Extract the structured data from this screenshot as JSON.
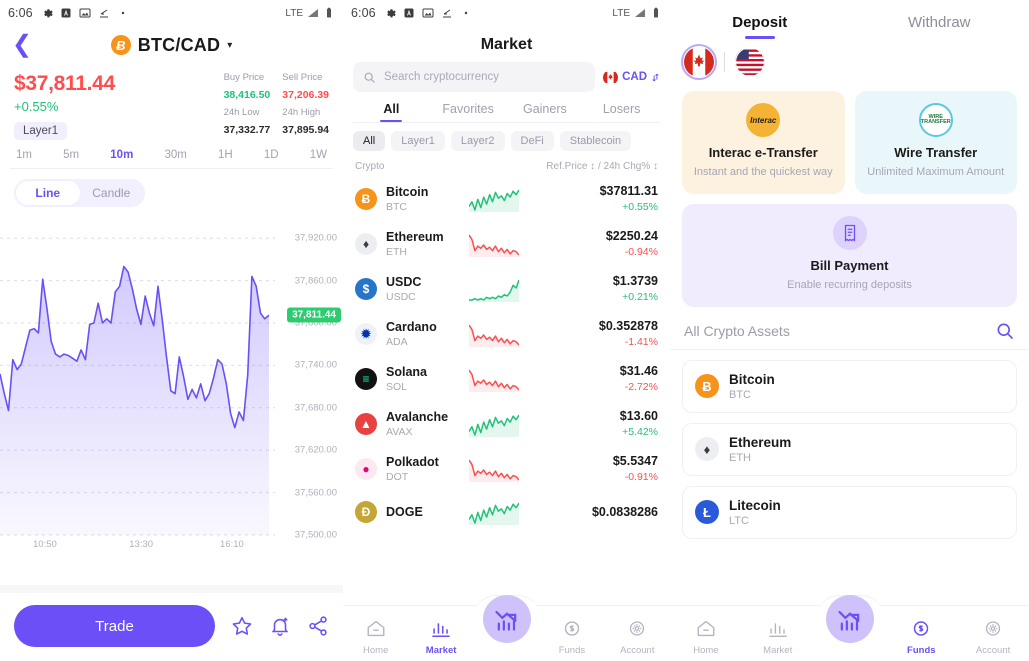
{
  "status_bar": {
    "time": "6:06",
    "icons": [
      "gear-icon",
      "app-icon",
      "gallery-icon",
      "download-icon",
      "dot-icon"
    ],
    "network": "LTE",
    "signal_icon": "signal-icon",
    "battery_icon": "battery-icon"
  },
  "trade_screen": {
    "back_icon": "chevron-left-icon",
    "pair": "BTC/CAD",
    "coin_glyph": "Ƀ",
    "caret": "▾",
    "price": "$37,811.44",
    "change": "+0.55%",
    "badge": "Layer1",
    "stats": [
      {
        "label": "Buy Price",
        "value": "38,416.50",
        "tone": "green"
      },
      {
        "label": "Sell Price",
        "value": "37,206.39",
        "tone": "red"
      },
      {
        "label": "24h Low",
        "value": "37,332.77",
        "tone": "dark"
      },
      {
        "label": "24h High",
        "value": "37,895.94",
        "tone": "dark"
      }
    ],
    "timeframes": [
      "1m",
      "5m",
      "10m",
      "30m",
      "1H",
      "1D",
      "1W"
    ],
    "timeframe_active": "10m",
    "chart_types": [
      "Line",
      "Candle"
    ],
    "chart_type_active": "Line",
    "current_price_badge": "37,811.44",
    "trade_button": "Trade",
    "actions": [
      "star-icon",
      "bell-icon",
      "share-icon"
    ]
  },
  "chart_data": {
    "type": "area",
    "title": "BTC/CAD 10m",
    "xlabel": "",
    "ylabel": "",
    "grid": true,
    "legend": "none",
    "ylim": [
      37500,
      37950
    ],
    "y_ticks": [
      "37,920.00",
      "37,860.00",
      "37,800.00",
      "37,740.00",
      "37,680.00",
      "37,620.00",
      "37,560.00",
      "37,500.00"
    ],
    "y_tick_values": [
      37920,
      37860,
      37800,
      37740,
      37680,
      37620,
      37560,
      37500
    ],
    "x_ticks": [
      "10:50",
      "13:30",
      "16:10"
    ],
    "current_value": 37811.44,
    "series": [
      {
        "name": "BTC/CAD",
        "color": "#6c4ff7",
        "values": [
          37728,
          37700,
          37676,
          37748,
          37734,
          37742,
          37766,
          37790,
          37792,
          37786,
          37862,
          37820,
          37774,
          37756,
          37752,
          37756,
          37754,
          37750,
          37746,
          37762,
          37748,
          37798,
          37800,
          37828,
          37800,
          37806,
          37800,
          37844,
          37852,
          37880,
          37872,
          37848,
          37820,
          37798,
          37838,
          37814,
          37796,
          37852,
          37804,
          37752,
          37704,
          37700,
          37752,
          37724,
          37692,
          37706,
          37694,
          37714,
          37690,
          37700,
          37722,
          37748,
          37742,
          37714,
          37672,
          37652,
          37674,
          37662,
          37726,
          37866,
          37852,
          37814,
          37806,
          37811
        ]
      }
    ]
  },
  "market_screen": {
    "title": "Market",
    "search": {
      "placeholder": "Search cryptocurrency",
      "icon": "search-icon"
    },
    "currency": {
      "label": "CAD",
      "flag": "ca-flag-icon",
      "swap_icon": "swap-vertical-icon"
    },
    "tabs": [
      "All",
      "Favorites",
      "Gainers",
      "Losers"
    ],
    "tab_active": "All",
    "pills": [
      "All",
      "Layer1",
      "Layer2",
      "DeFi",
      "Stablecoin"
    ],
    "pill_active": "All",
    "columns": {
      "left": "Crypto",
      "right": "Ref.Price ↕ / 24h Chg% ↕"
    },
    "rows": [
      {
        "name": "Bitcoin",
        "symbol": "BTC",
        "price": "$37811.31",
        "change": "+0.55%",
        "dir": "up",
        "icon": "bitcoin-icon"
      },
      {
        "name": "Ethereum",
        "symbol": "ETH",
        "price": "$2250.24",
        "change": "-0.94%",
        "dir": "down",
        "icon": "ethereum-icon"
      },
      {
        "name": "USDC",
        "symbol": "USDC",
        "price": "$1.3739",
        "change": "+0.21%",
        "dir": "up",
        "icon": "usdc-icon"
      },
      {
        "name": "Cardano",
        "symbol": "ADA",
        "price": "$0.352878",
        "change": "-1.41%",
        "dir": "down",
        "icon": "cardano-icon"
      },
      {
        "name": "Solana",
        "symbol": "SOL",
        "price": "$31.46",
        "change": "-2.72%",
        "dir": "down",
        "icon": "solana-icon"
      },
      {
        "name": "Avalanche",
        "symbol": "AVAX",
        "price": "$13.60",
        "change": "+5.42%",
        "dir": "up",
        "icon": "avalanche-icon"
      },
      {
        "name": "Polkadot",
        "symbol": "DOT",
        "price": "$5.5347",
        "change": "-0.91%",
        "dir": "down",
        "icon": "polkadot-icon"
      },
      {
        "name": "DOGE",
        "symbol": "",
        "price": "$0.0838286",
        "change": "",
        "dir": "up",
        "icon": "doge-icon"
      }
    ],
    "nav": {
      "items": [
        {
          "label": "Home",
          "icon": "home-icon"
        },
        {
          "label": "Market",
          "icon": "market-bars-icon"
        },
        {
          "label": "Funds",
          "icon": "piggy-bank-icon"
        },
        {
          "label": "Account",
          "icon": "account-gear-icon"
        }
      ],
      "active": "Market",
      "center_icon": "trend-chart-icon"
    }
  },
  "funds_screen": {
    "tabs": [
      "Deposit",
      "Withdraw"
    ],
    "tab_active": "Deposit",
    "flags": [
      {
        "name": "ca-flag-icon",
        "selected": true
      },
      {
        "name": "us-flag-icon",
        "selected": false
      }
    ],
    "methods": [
      {
        "title": "Interac e-Transfer",
        "subtitle": "Instant and the quickest way",
        "icon": "interac-icon"
      },
      {
        "title": "Wire Transfer",
        "subtitle": "Unlimited Maximum Amount",
        "icon": "wire-transfer-icon"
      },
      {
        "title": "Bill Payment",
        "subtitle": "Enable recurring deposits",
        "icon": "bill-payment-icon"
      }
    ],
    "assets_header": {
      "title": "All Crypto Assets",
      "search_icon": "search-icon"
    },
    "assets": [
      {
        "name": "Bitcoin",
        "symbol": "BTC",
        "icon": "bitcoin-icon"
      },
      {
        "name": "Ethereum",
        "symbol": "ETH",
        "icon": "ethereum-icon"
      },
      {
        "name": "Litecoin",
        "symbol": "LTC",
        "icon": "litecoin-icon"
      }
    ],
    "nav": {
      "items": [
        {
          "label": "Home",
          "icon": "home-icon"
        },
        {
          "label": "Market",
          "icon": "market-bars-icon"
        },
        {
          "label": "Funds",
          "icon": "piggy-bank-icon"
        },
        {
          "label": "Account",
          "icon": "account-gear-icon"
        }
      ],
      "active": "Funds",
      "center_icon": "trend-chart-icon"
    }
  },
  "colors": {
    "accent": "#6c4ff7",
    "up": "#21c17a",
    "down": "#ff4d4f",
    "bitcoin": "#f7931a",
    "badge_green": "#2ecc71"
  }
}
